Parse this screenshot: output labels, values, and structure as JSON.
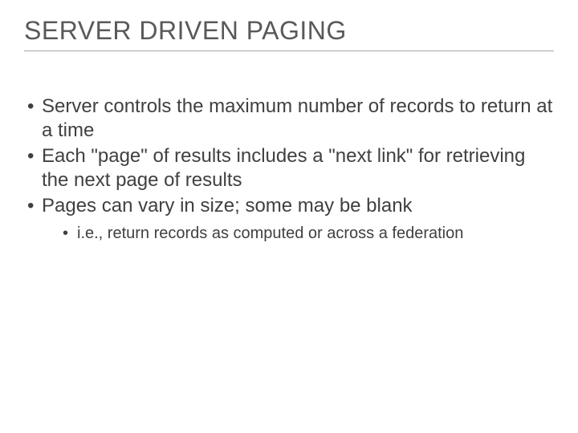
{
  "title": "SERVER DRIVEN PAGING",
  "bullets": [
    {
      "text": "Server controls the maximum number of records to return at a time"
    },
    {
      "text": "Each \"page\" of results includes a \"next link\" for retrieving the next page of results"
    },
    {
      "text": "Pages can vary in size; some may be blank",
      "sub": [
        {
          "text": "i.e., return records as computed or across a federation"
        }
      ]
    }
  ]
}
